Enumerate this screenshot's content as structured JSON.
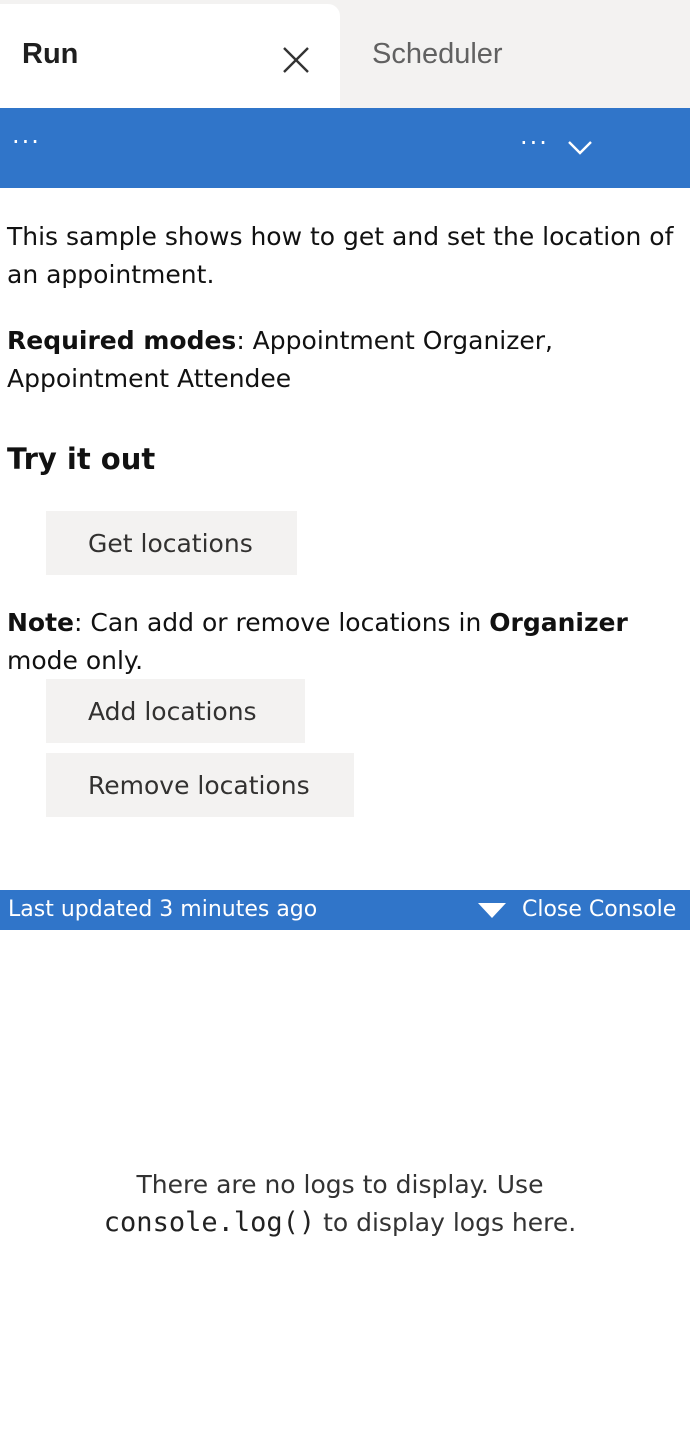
{
  "tabs": {
    "run_label": "Run",
    "close_icon": "close-icon",
    "scheduler_label": "Scheduler"
  },
  "toolbar": {
    "left_overflow": "···",
    "right_overflow": "···",
    "chevron_icon": "chevron-down-icon"
  },
  "content": {
    "description": "This sample shows how to get and set the location of an appointment.",
    "modes_label": "Required modes",
    "modes_value": ": Appointment Organizer, Appointment Attendee",
    "heading": "Try it out",
    "get_button": "Get locations",
    "note_label": "Note",
    "note_text_1": ": Can add or remove locations in ",
    "note_bold": "Organizer",
    "note_text_2": " mode only.",
    "add_button": "Add locations",
    "remove_button": "Remove locations"
  },
  "console": {
    "last_updated": "Last updated 3 minutes ago",
    "close_label": "Close Console",
    "empty_line_1": "There are no logs to display. Use",
    "empty_code": "console.log()",
    "empty_line_2": " to display logs here."
  },
  "colors": {
    "accent": "#3075c9",
    "tab_background": "#f3f2f1",
    "button_background": "#f3f2f1"
  }
}
